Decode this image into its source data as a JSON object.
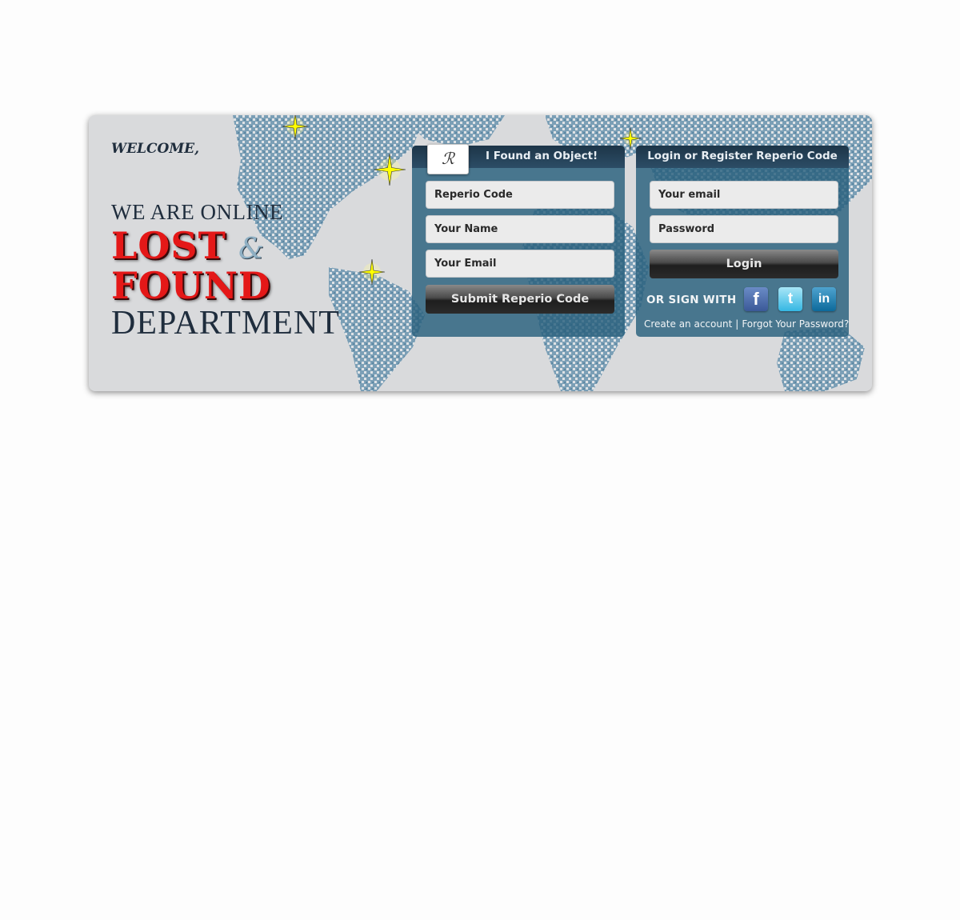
{
  "hero": {
    "welcome": "WELCOME,",
    "online": "WE ARE ONLINE",
    "lost": "LOST",
    "amp": "&",
    "found": "FOUND",
    "department": "DEPARTMENT"
  },
  "found_panel": {
    "title": "I Found an Object!",
    "logo_text": "ℛ",
    "reperio_code_placeholder": "Reperio Code",
    "name_placeholder": "Your Name",
    "email_placeholder": "Your Email",
    "submit_label": "Submit Reperio Code"
  },
  "login_panel": {
    "title": "Login or Register Reperio Code",
    "email_placeholder": "Your email",
    "password_placeholder": "Password",
    "login_label": "Login",
    "or_sign_with": "OR SIGN WITH",
    "social": [
      {
        "icon": "facebook-icon",
        "glyph": "f",
        "color": "#3b5998"
      },
      {
        "icon": "twitter-icon",
        "glyph": "t",
        "color": "#35b7e3"
      },
      {
        "icon": "linkedin-icon",
        "glyph": "in",
        "color": "#0d6a9b"
      }
    ],
    "create_account": "Create an account",
    "separator": "|",
    "forgot_password": "Forgot Your Password?"
  },
  "colors": {
    "banner_bg": "#d9dadc",
    "panel_bg": "#285f7d",
    "accent_red": "#e41818",
    "map_dots": "#5f8ca8",
    "star": "#ffff00"
  }
}
